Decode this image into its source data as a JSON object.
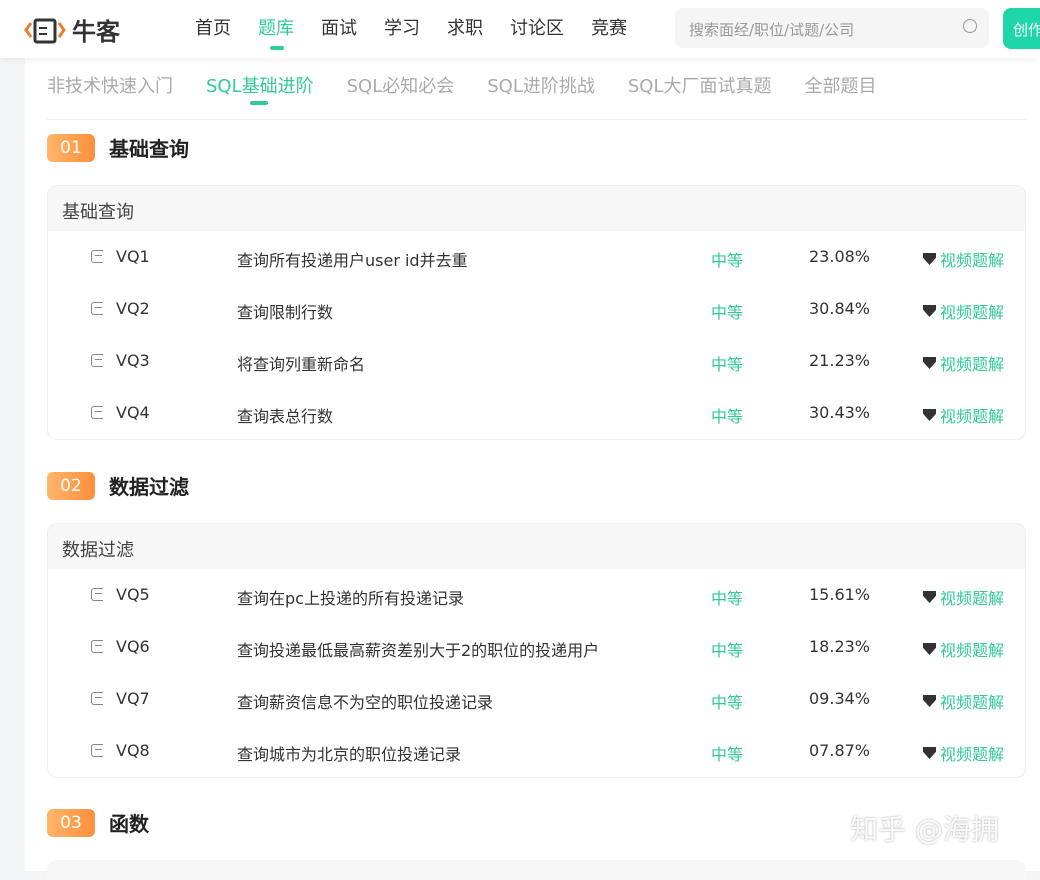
{
  "header": {
    "logo_text": "牛客",
    "nav": [
      "首页",
      "题库",
      "面试",
      "学习",
      "求职",
      "讨论区",
      "竞赛"
    ],
    "active_nav": 1,
    "search_placeholder": "搜索面经/职位/试题/公司",
    "create_label": "创作"
  },
  "tabs": [
    "非技术快速入门",
    "SQL基础进阶",
    "SQL必知必会",
    "SQL进阶挑战",
    "SQL大厂面试真题",
    "全部题目"
  ],
  "sections": [
    {
      "num": "01",
      "title": "基础查询",
      "card_title": "基础查询",
      "rows": [
        {
          "id": "VQ1",
          "title": "查询所有投递用户user id并去重",
          "difficulty": "中等",
          "rate": "23.08%",
          "video": "视频题解"
        },
        {
          "id": "VQ2",
          "title": "查询限制行数",
          "difficulty": "中等",
          "rate": "30.84%",
          "video": "视频题解"
        },
        {
          "id": "VQ3",
          "title": "将查询列重新命名",
          "difficulty": "中等",
          "rate": "21.23%",
          "video": "视频题解"
        },
        {
          "id": "VQ4",
          "title": "查询表总行数",
          "difficulty": "中等",
          "rate": "30.43%",
          "video": "视频题解"
        }
      ]
    },
    {
      "num": "02",
      "title": "数据过滤",
      "card_title": "数据过滤",
      "rows": [
        {
          "id": "VQ5",
          "title": "查询在pc上投递的所有投递记录",
          "difficulty": "中等",
          "rate": "15.61%",
          "video": "视频题解"
        },
        {
          "id": "VQ6",
          "title": "查询投递最低最高薪资差别大于2的职位的投递用户",
          "difficulty": "中等",
          "rate": "18.23%",
          "video": "视频题解"
        },
        {
          "id": "VQ7",
          "title": "查询薪资信息不为空的职位投递记录",
          "difficulty": "中等",
          "rate": "09.34%",
          "video": "视频题解"
        },
        {
          "id": "VQ8",
          "title": "查询城市为北京的职位投递记录",
          "difficulty": "中等",
          "rate": "07.87%",
          "video": "视频题解"
        }
      ]
    },
    {
      "num": "03",
      "title": "函数"
    }
  ],
  "watermark": "知乎 @海拥",
  "colors": {
    "accent": "#32ca99",
    "badge": "#ff8f3c"
  }
}
